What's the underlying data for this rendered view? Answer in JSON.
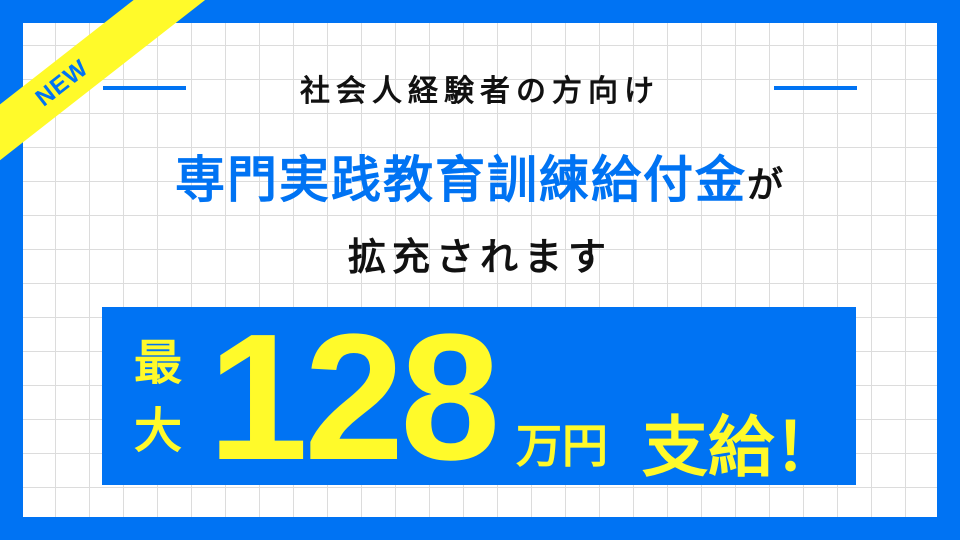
{
  "badge": "NEW",
  "subtitle": "社会人経験者の方向け",
  "title": {
    "main": "専門実践教育訓練給付金",
    "particle": "が"
  },
  "title2": "拡充されます",
  "highlight": {
    "prefix": "最大",
    "amount": "128",
    "unit": "万円",
    "suffix": "支給！"
  },
  "colors": {
    "blue": "#0073f3",
    "yellow": "#fffa2a"
  }
}
